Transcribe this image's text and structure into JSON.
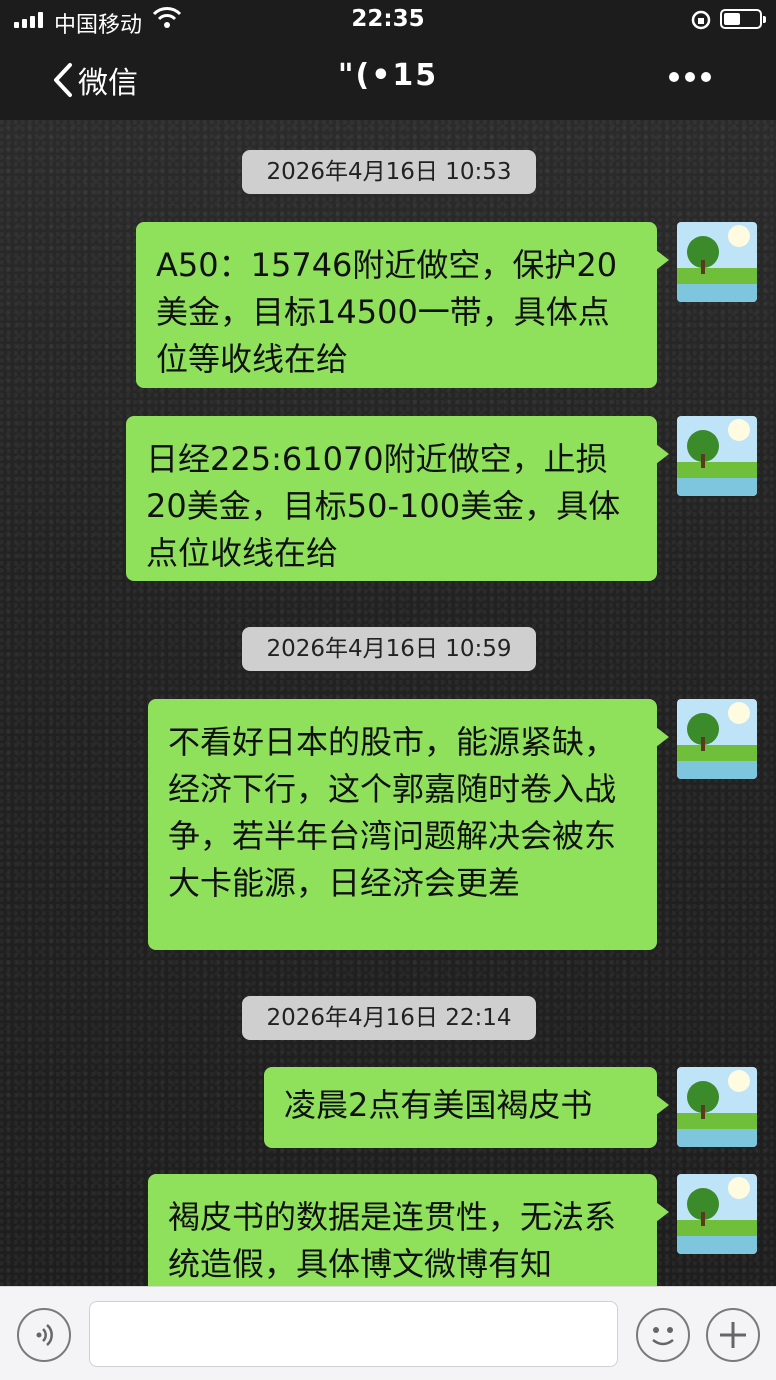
{
  "status_bar": {
    "carrier": "中国移动",
    "time": "22:35"
  },
  "nav": {
    "back_label": "微信",
    "title": "\"(•15"
  },
  "messages": [
    {
      "type": "timestamp",
      "text": "2026年4月16日 10:53"
    },
    {
      "type": "sent",
      "text": "A50：15746附近做空，保护20美金，目标14500一带，具体点位等收线在给"
    },
    {
      "type": "sent",
      "text": "日经225:61070附近做空，止损20美金，目标50-100美金，具体点位收线在给"
    },
    {
      "type": "timestamp",
      "text": "2026年4月16日 10:59"
    },
    {
      "type": "sent",
      "text": "不看好日本的股市，能源紧缺，经济下行，这个郭嘉随时卷入战争，若半年台湾问题解决会被东大卡能源，日经济会更差"
    },
    {
      "type": "timestamp",
      "text": "2026年4月16日 22:14"
    },
    {
      "type": "sent",
      "text": "凌晨2点有美国褐皮书"
    },
    {
      "type": "sent",
      "text": "褐皮书的数据是连贯性，无法系统造假，具体博文微博有知"
    }
  ],
  "colors": {
    "bubble": "#8fe05b",
    "timestamp_bg": "#cfcfcf",
    "bar_bg": "#1c1c1c"
  }
}
